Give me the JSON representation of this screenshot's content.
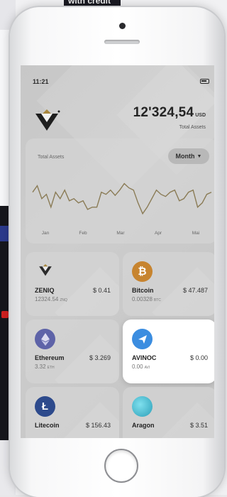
{
  "background": {
    "top_banner_text": "with credit"
  },
  "status_bar": {
    "time": "11:21"
  },
  "summary": {
    "amount": "12'324,54",
    "currency": "USD",
    "label": "Total Assets"
  },
  "chart_card": {
    "title": "Total Assets",
    "period_button": "Month"
  },
  "chart_data": {
    "type": "line",
    "title": "Total Assets",
    "x": [
      "Jan",
      "Feb",
      "Mar",
      "Apr",
      "Mai"
    ],
    "series": [
      {
        "values": [
          58,
          64,
          52,
          56,
          44,
          58,
          52,
          60,
          50,
          52,
          48,
          50,
          42,
          44,
          44,
          58,
          56,
          60,
          55,
          60,
          66,
          62,
          60,
          48,
          38,
          44,
          52,
          60,
          56,
          54,
          58,
          60,
          50,
          52,
          58,
          60,
          44,
          48,
          56,
          58
        ]
      }
    ],
    "grid": false,
    "color": "#8a7b55"
  },
  "assets": [
    {
      "name": "ZENIQ",
      "price": "$ 0.41",
      "holding": "12324.54",
      "unit": "ZNQ",
      "icon": "zeniq-logo-icon",
      "color": "#3b3b3b"
    },
    {
      "name": "Bitcoin",
      "price": "$ 47.487",
      "holding": "0.00328",
      "unit": "BTC",
      "icon": "bitcoin-icon",
      "color": "#c7842f"
    },
    {
      "name": "Ethereum",
      "price": "$ 3.269",
      "holding": "3.32",
      "unit": "ETH",
      "icon": "ethereum-icon",
      "color": "#5e63a8"
    },
    {
      "name": "AVINOC",
      "price": "$ 0.00",
      "holding": "0.00",
      "unit": "AVI",
      "icon": "avinoc-icon",
      "color": "#3b8de0",
      "selected": true
    },
    {
      "name": "Litecoin",
      "price": "$ 156.43",
      "holding": "",
      "unit": "",
      "icon": "litecoin-icon",
      "color": "#2d4a8c"
    },
    {
      "name": "Aragon",
      "price": "$ 3.51",
      "holding": "",
      "unit": "",
      "icon": "aragon-icon",
      "color": "#2c9fb8"
    }
  ]
}
